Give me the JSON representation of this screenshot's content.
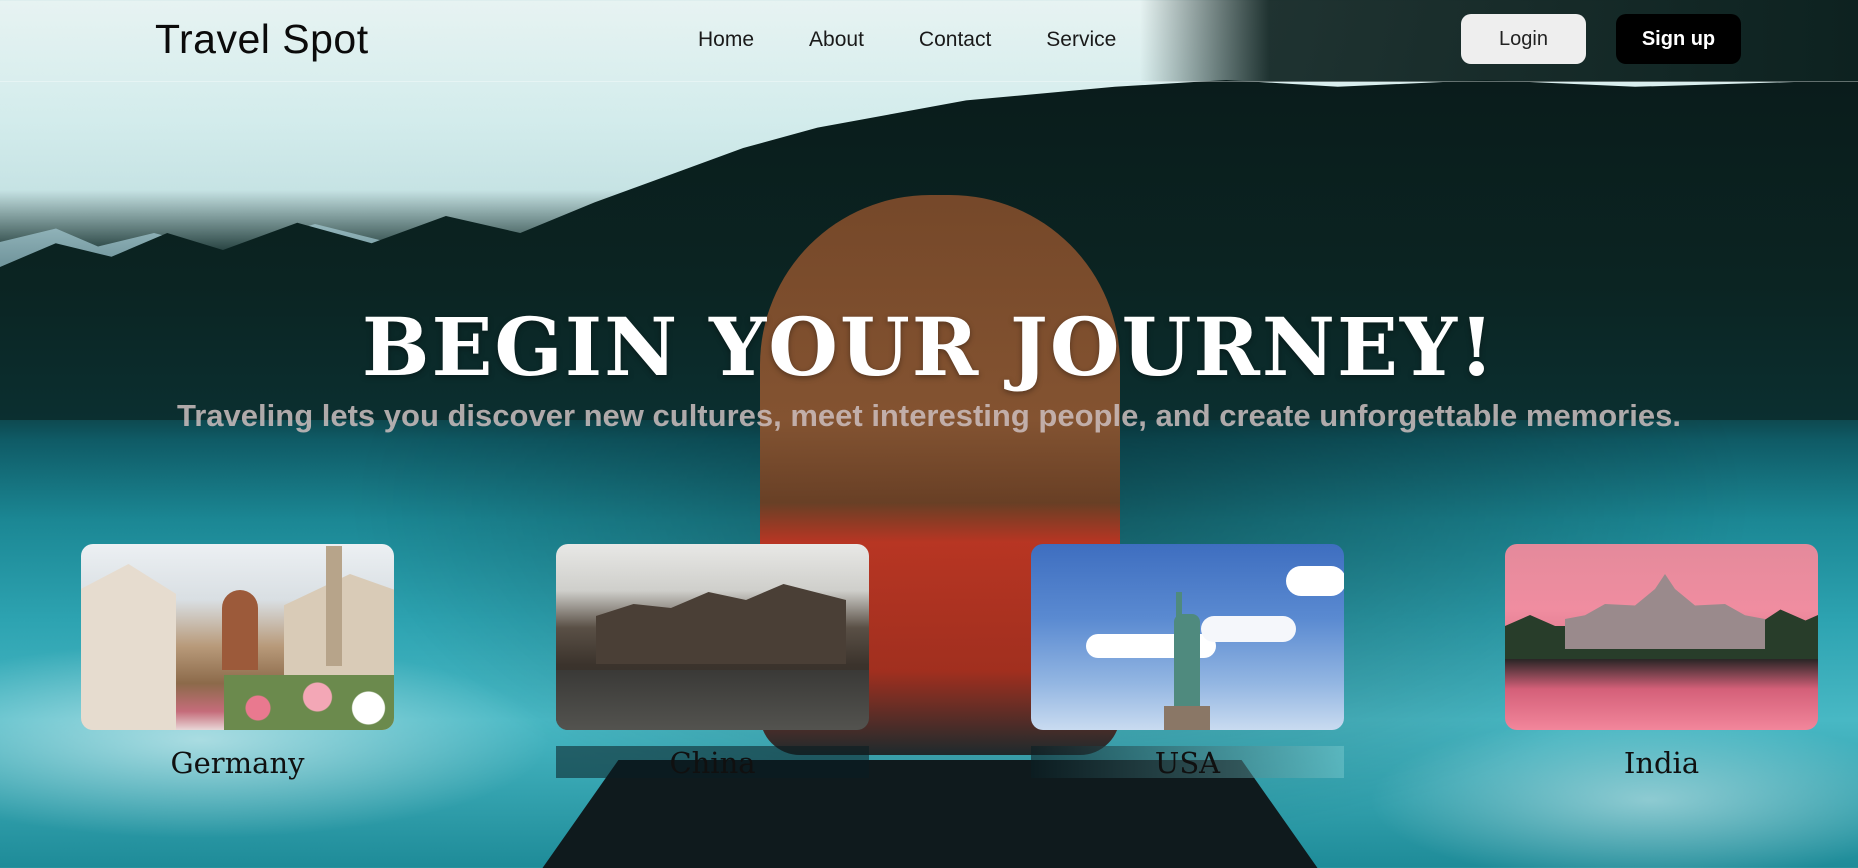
{
  "brand": "Travel Spot",
  "nav": {
    "home": "Home",
    "about": "About",
    "contact": "Contact",
    "service": "Service"
  },
  "auth": {
    "login": "Login",
    "signup": "Sign up"
  },
  "hero": {
    "title": "BEGIN YOUR JOURNEY!",
    "subtitle": "Traveling lets you discover new cultures, meet interesting people, and create unforgettable memories."
  },
  "destinations": [
    {
      "name": "Germany"
    },
    {
      "name": "China"
    },
    {
      "name": "USA"
    },
    {
      "name": "India"
    }
  ]
}
